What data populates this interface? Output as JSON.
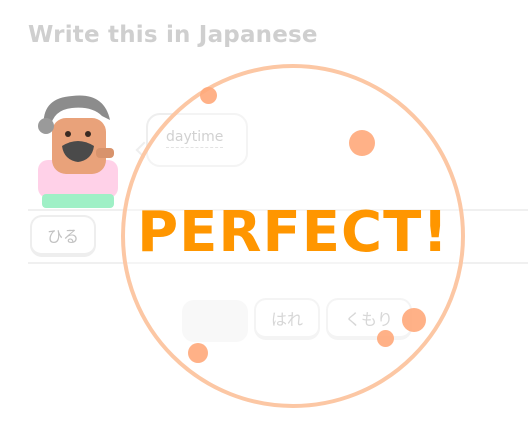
{
  "prompt": {
    "title": "Write this in Japanese"
  },
  "bubble": {
    "word": "daytime"
  },
  "answer": {
    "tiles": [
      "ひる"
    ]
  },
  "bank": {
    "tiles": [
      "",
      "はれ",
      "くもり"
    ]
  },
  "feedback": {
    "text": "PERFECT!"
  },
  "colors": {
    "accent": "#ff9600",
    "ring": "#fcc7a4",
    "dot": "#ffa87a",
    "title": "#cfcfcf"
  }
}
